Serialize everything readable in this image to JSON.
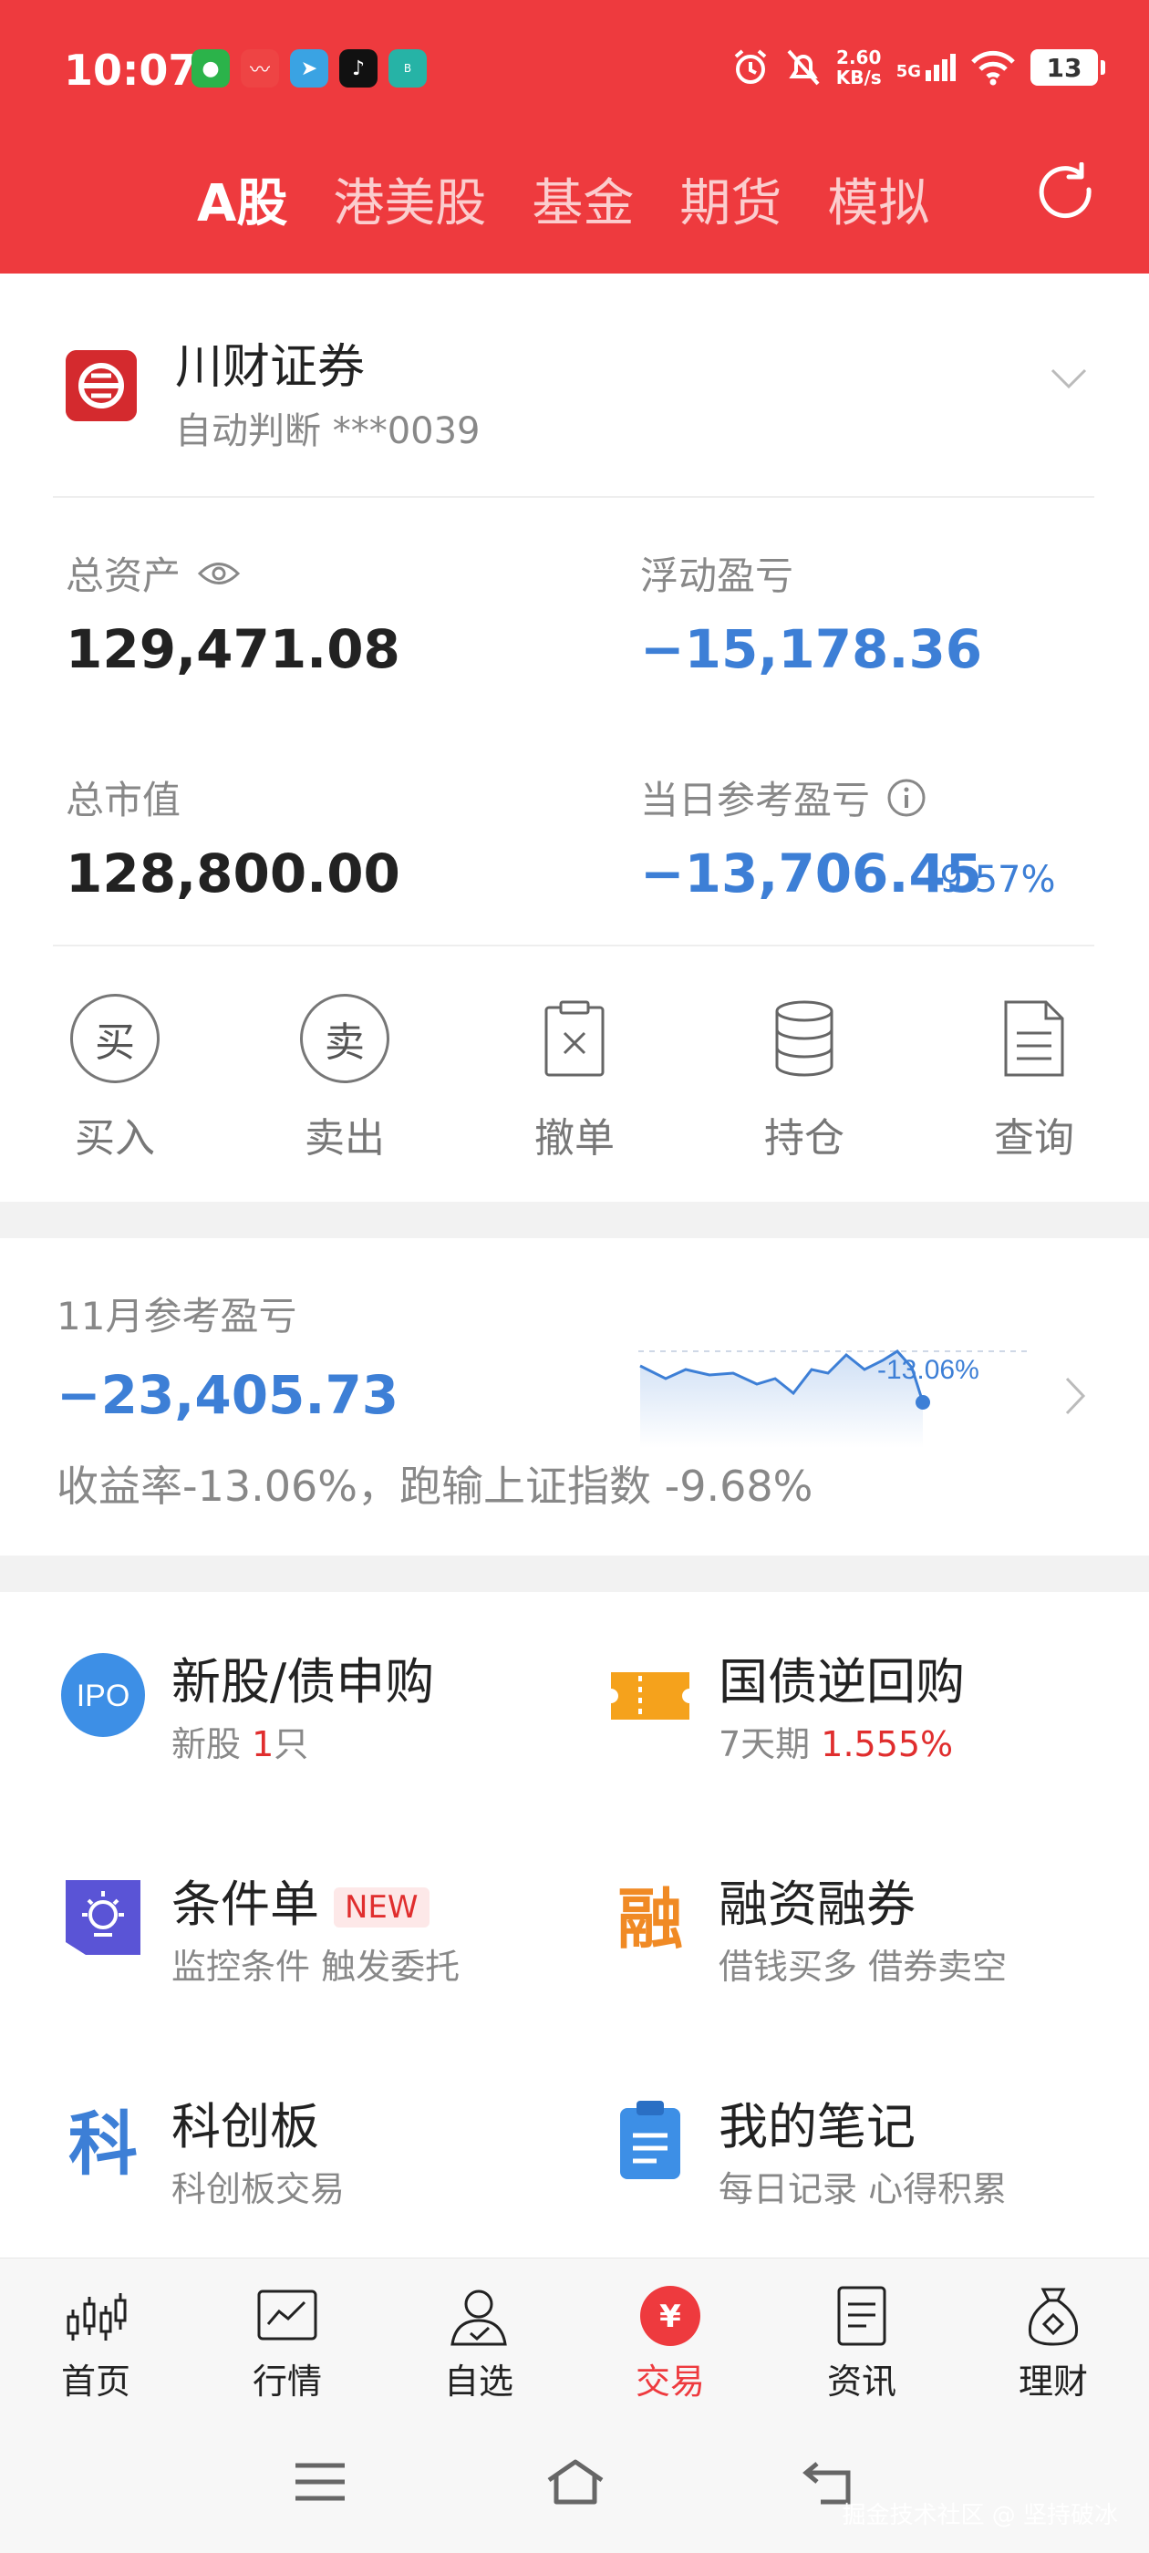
{
  "status_bar": {
    "time": "10:07",
    "speed_value": "2.60",
    "speed_unit": "KB/s",
    "network": "5G",
    "battery": "13"
  },
  "tabs": [
    {
      "label": "A股"
    },
    {
      "label": "港美股"
    },
    {
      "label": "基金"
    },
    {
      "label": "期货"
    },
    {
      "label": "模拟"
    }
  ],
  "account": {
    "broker_name": "川财证券",
    "sub": "自动判断 ***0039"
  },
  "metrics": {
    "total_assets_label": "总资产",
    "total_assets_value": "129,471.08",
    "floating_pl_label": "浮动盈亏",
    "floating_pl_value": "−15,178.36",
    "market_value_label": "总市值",
    "market_value_value": "128,800.00",
    "daily_pl_label": "当日参考盈亏",
    "daily_pl_value": "−13,706.45",
    "daily_pl_pct": "-9.57%"
  },
  "quick_actions": [
    {
      "label": "买入",
      "glyph": "买"
    },
    {
      "label": "卖出",
      "glyph": "卖"
    },
    {
      "label": "撤单"
    },
    {
      "label": "持仓"
    },
    {
      "label": "查询"
    }
  ],
  "monthly": {
    "title": "11月参考盈亏",
    "value": "−23,405.73",
    "rate_text": "收益率-13.06%，跑输上证指数 -9.68%",
    "chart_label": "-13.06%"
  },
  "services": [
    {
      "title": "新股/债申购",
      "sub_prefix": "新股 ",
      "sub_highlight": "1",
      "sub_suffix": "只",
      "icon_text": "IPO"
    },
    {
      "title": "国债逆回购",
      "sub_prefix": "7天期 ",
      "sub_highlight": "1.555%",
      "sub_suffix": ""
    },
    {
      "title": "条件单",
      "badge": "NEW",
      "sub_prefix": "监控条件 触发委托",
      "sub_highlight": "",
      "sub_suffix": ""
    },
    {
      "title": "融资融券",
      "sub_prefix": "借钱买多 借券卖空",
      "sub_highlight": "",
      "sub_suffix": "",
      "icon_text": "融"
    },
    {
      "title": "科创板",
      "sub_prefix": "科创板交易",
      "sub_highlight": "",
      "sub_suffix": "",
      "icon_text": "科"
    },
    {
      "title": "我的笔记",
      "sub_prefix": "每日记录 心得积累",
      "sub_highlight": "",
      "sub_suffix": ""
    }
  ],
  "bottom_nav": [
    {
      "label": "首页"
    },
    {
      "label": "行情"
    },
    {
      "label": "自选"
    },
    {
      "label": "交易",
      "icon_text": "¥"
    },
    {
      "label": "资讯"
    },
    {
      "label": "理财"
    }
  ],
  "watermark": "掘金技术社区 @ 坚持破冰",
  "colors": {
    "brand_red": "#ee3a3e",
    "loss_blue": "#3d7fd6",
    "highlight_red": "#e02e2e"
  }
}
